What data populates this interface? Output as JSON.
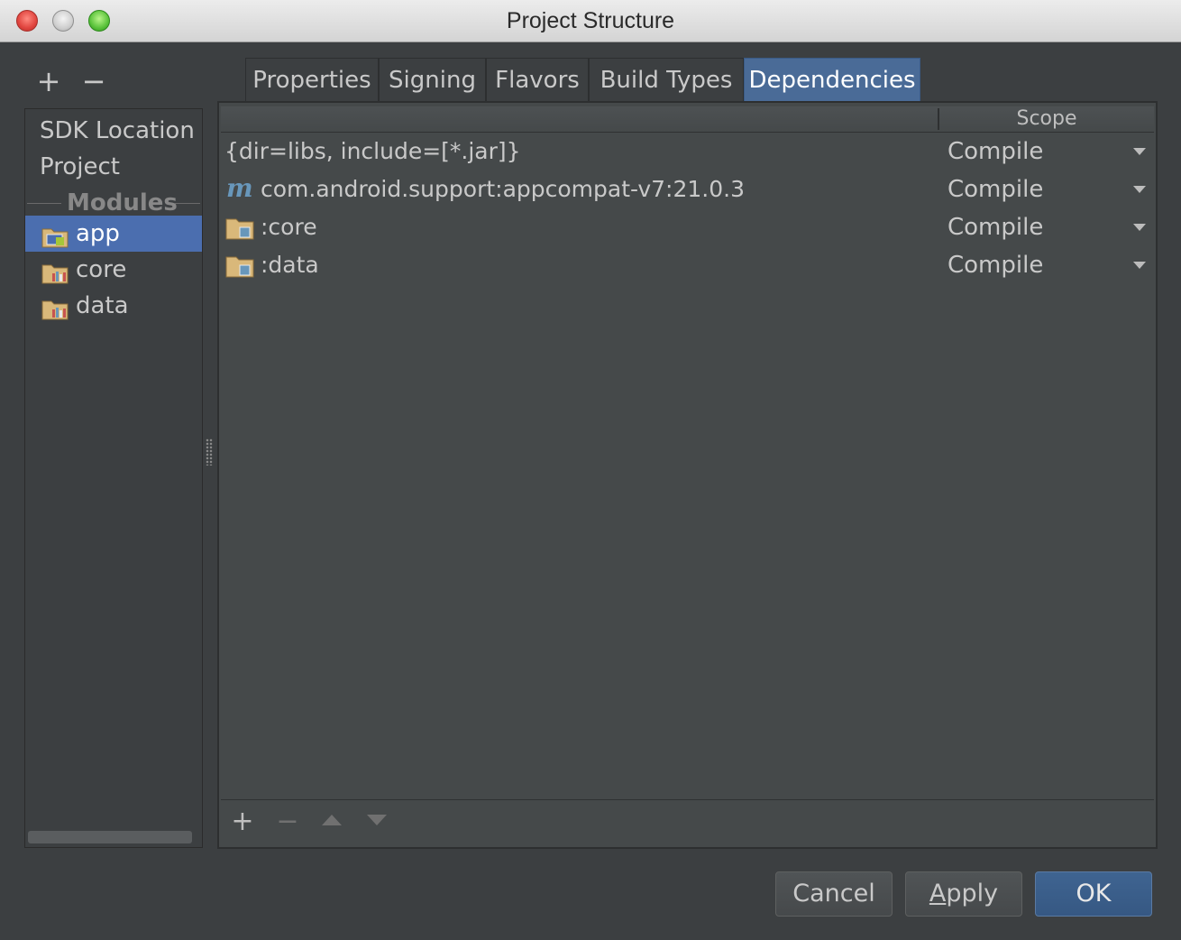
{
  "window": {
    "title": "Project Structure"
  },
  "left_toolbar": {
    "add": "+",
    "remove": "−"
  },
  "sidebar": {
    "items": [
      {
        "label": "SDK Location"
      },
      {
        "label": "Project"
      }
    ],
    "section_label": "Modules",
    "modules": [
      {
        "label": "app",
        "selected": true
      },
      {
        "label": "core",
        "selected": false
      },
      {
        "label": "data",
        "selected": false
      }
    ]
  },
  "tabs": [
    {
      "label": "Properties"
    },
    {
      "label": "Signing"
    },
    {
      "label": "Flavors"
    },
    {
      "label": "Build Types"
    },
    {
      "label": "Dependencies",
      "active": true
    }
  ],
  "table": {
    "columns": {
      "name": "",
      "scope": "Scope"
    },
    "rows": [
      {
        "name": "{dir=libs, include=[*.jar]}",
        "icon": "none",
        "scope": "Compile"
      },
      {
        "name": "com.android.support:appcompat-v7:21.0.3",
        "icon": "maven-icon",
        "scope": "Compile"
      },
      {
        "name": ":core",
        "icon": "module-folder-icon",
        "scope": "Compile"
      },
      {
        "name": ":data",
        "icon": "module-folder-icon",
        "scope": "Compile"
      }
    ]
  },
  "table_toolbar": {
    "add": "+",
    "remove": "−"
  },
  "buttons": {
    "cancel": "Cancel",
    "apply_first": "A",
    "apply_rest": "pply",
    "ok": "OK"
  },
  "colors": {
    "selection": "#4b6eaf",
    "active_tab": "#4a6b97",
    "background": "#3c3f41"
  }
}
